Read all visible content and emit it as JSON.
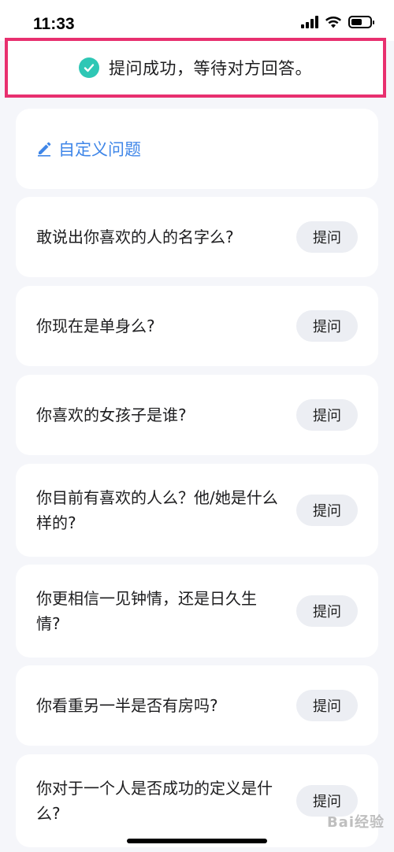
{
  "status_bar": {
    "time": "11:33"
  },
  "toast": {
    "message": "提问成功，等待对方回答。",
    "icon": "check-circle-icon",
    "highlight_color": "#e8306f",
    "icon_color": "#2ec7b5"
  },
  "custom_question": {
    "label": "自定义问题",
    "icon": "pencil-icon",
    "color": "#3f86e8"
  },
  "questions": [
    {
      "text": "敢说出你喜欢的人的名字么?",
      "button": "提问"
    },
    {
      "text": "你现在是单身么?",
      "button": "提问"
    },
    {
      "text": "你喜欢的女孩子是谁?",
      "button": "提问"
    },
    {
      "text": "你目前有喜欢的人么？他/她是什么样的?",
      "button": "提问"
    },
    {
      "text": "你更相信一见钟情，还是日久生情?",
      "button": "提问"
    },
    {
      "text": "你看重另一半是否有房吗?",
      "button": "提问"
    },
    {
      "text": "你对于一个人是否成功的定义是什么?",
      "button": "提问"
    }
  ],
  "watermark": {
    "text": "Bai经验"
  }
}
